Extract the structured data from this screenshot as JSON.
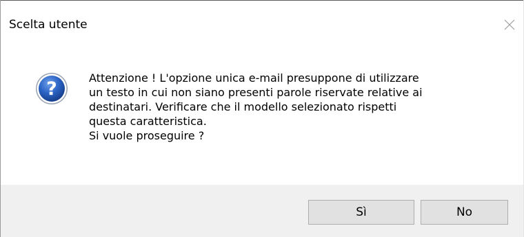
{
  "window": {
    "title": "Scelta utente",
    "close_icon": "close-icon"
  },
  "dialog": {
    "icon": "question-icon",
    "message_lines": [
      "Attenzione ! L'opzione unica e-mail presuppone di utilizzare",
      "un testo in cui non siano presenti parole riservate relative ai",
      "destinatari. Verificare che il modello selezionato rispetti",
      "questa caratteristica.",
      "Si vuole proseguire ?"
    ]
  },
  "buttons": {
    "yes_label": "Sì",
    "no_label": "No"
  },
  "colors": {
    "icon_blue": "#2a63c4",
    "footer_bg": "#f0f0f0",
    "button_bg": "#e1e1e1"
  }
}
